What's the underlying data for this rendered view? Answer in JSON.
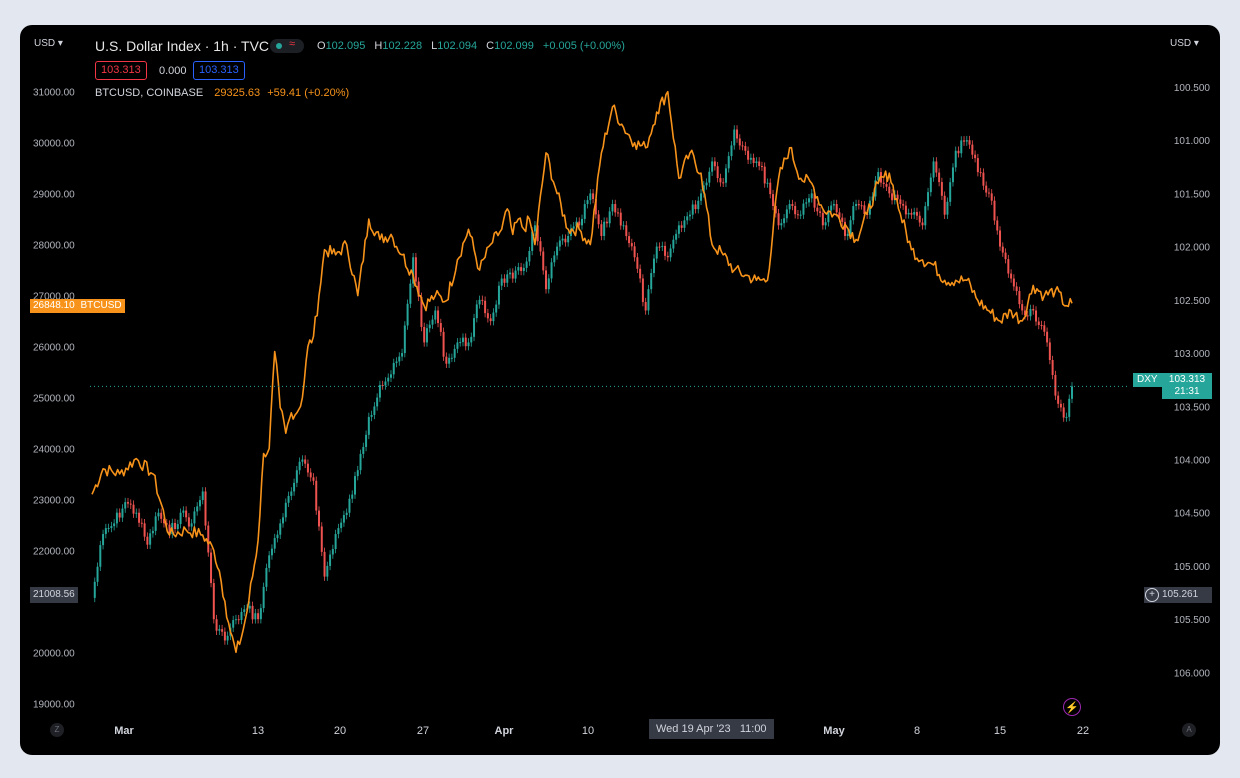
{
  "header": {
    "currency_left": "USD",
    "currency_right": "USD",
    "title": "U.S. Dollar Index · 1h · TVC",
    "wave_icon": "≈",
    "ohlc": [
      {
        "k": "O",
        "v": "102.095"
      },
      {
        "k": "H",
        "v": "102.228"
      },
      {
        "k": "L",
        "v": "102.094"
      },
      {
        "k": "C",
        "v": "102.099"
      }
    ],
    "change": "+0.005 (+0.00%)",
    "bid": "103.313",
    "spread": "0.000",
    "ask": "103.313",
    "btc_symbol": "BTCUSD, COINBASE",
    "btc_price": "29325.63",
    "btc_change": "+59.41 (+0.20%)"
  },
  "badges": {
    "btc_price": "26848.10",
    "btc_label": "BTCUSD",
    "dxy_label": "DXY",
    "dxy_price": "103.313",
    "dxy_countdown": "21:31",
    "left_crosshair": "21008.56",
    "right_crosshair": "105.261",
    "time_label": "Wed 19 Apr '23   11:00"
  },
  "footer": {
    "left_btn": "Z",
    "right_btn": "A"
  },
  "colors": {
    "btc": "#f7931a",
    "dxy_up": "#26a69a",
    "dxy_down": "#ef5350",
    "bg": "#000000"
  },
  "chart_data": {
    "type": "line",
    "x_ticks": [
      "Mar",
      "13",
      "20",
      "27",
      "Apr",
      "10",
      "Wed 19 Apr '23   11:00",
      "May",
      "8",
      "15",
      "22"
    ],
    "left_axis": {
      "ticks": [
        "31000.00",
        "30000.00",
        "29000.00",
        "28000.00",
        "27000.00",
        "26000.00",
        "25000.00",
        "24000.00",
        "23000.00",
        "22000.00",
        "20000.00",
        "19000.00"
      ],
      "range": [
        18770,
        31720
      ]
    },
    "right_axis": {
      "ticks": [
        "100.500",
        "101.000",
        "101.500",
        "102.000",
        "102.500",
        "103.000",
        "103.500",
        "104.000",
        "104.500",
        "105.000",
        "105.500",
        "106.000"
      ],
      "range": [
        100.2,
        106.4
      ],
      "inverted": true
    },
    "series": [
      {
        "name": "BTCUSD, COINBASE",
        "axis": "left",
        "x": [
          0,
          1,
          2.5,
          4,
          5.5,
          7,
          8.5,
          10,
          11,
          11.5,
          12,
          12.5,
          13,
          13.5,
          14,
          15,
          15.5,
          16,
          16.5,
          17,
          17.5,
          18,
          18.5,
          19,
          19.5,
          20,
          20.5,
          21,
          22,
          23,
          24,
          25,
          26,
          27,
          28,
          29,
          30,
          31,
          32,
          33,
          34,
          35,
          36,
          37,
          37.5,
          38,
          38.5,
          39,
          39.5,
          40,
          41,
          42,
          43,
          44,
          45,
          46,
          47,
          48,
          49,
          50,
          51,
          52,
          53,
          54,
          55,
          56,
          57,
          58,
          59,
          60,
          61,
          62,
          63,
          64,
          65,
          66,
          67,
          68,
          69,
          70,
          71,
          72,
          73,
          74,
          75,
          76,
          77,
          78,
          79,
          80,
          81,
          82,
          83,
          84,
          85,
          86,
          87,
          88,
          88.5
        ],
        "values": [
          23100,
          23600,
          23500,
          23800,
          23500,
          22300,
          22400,
          22300,
          22000,
          21600,
          21000,
          20400,
          20000,
          20300,
          20800,
          22200,
          23900,
          24000,
          25900,
          24800,
          24300,
          24700,
          24700,
          25000,
          26000,
          26200,
          27000,
          27900,
          27800,
          28000,
          27000,
          28500,
          28100,
          28200,
          27800,
          27400,
          26800,
          27000,
          26900,
          27700,
          28300,
          27500,
          28000,
          28300,
          28700,
          28200,
          28500,
          28300,
          28500,
          28000,
          29800,
          29000,
          28300,
          28300,
          28000,
          29800,
          30700,
          30300,
          30000,
          29900,
          30600,
          31000,
          29300,
          29800,
          29400,
          28000,
          27800,
          27500,
          27400,
          27300,
          27300,
          29300,
          29900,
          29300,
          29200,
          28700,
          28600,
          28400,
          28100,
          28600,
          29200,
          29400,
          28600,
          27900,
          27700,
          27600,
          27300,
          27300,
          27300,
          26900,
          26700,
          26500,
          26700,
          26500,
          27200,
          27000,
          27100,
          26800,
          26848
        ]
      },
      {
        "name": "U.S. Dollar Index · 1h · TVC",
        "axis": "right",
        "x": [
          0,
          1,
          2,
          3,
          4,
          5,
          6,
          7,
          8,
          9,
          10,
          11,
          12,
          13,
          14,
          15,
          16,
          17,
          18,
          19,
          20,
          21,
          22,
          23,
          24,
          25,
          26,
          27,
          28,
          29,
          30,
          31,
          32,
          33,
          34,
          35,
          36,
          37,
          38,
          39,
          40,
          41,
          42,
          43,
          44,
          45,
          46,
          47,
          48,
          49,
          50,
          51,
          52,
          53,
          54,
          55,
          56,
          57,
          58,
          59,
          60,
          61,
          62,
          63,
          64,
          65,
          66,
          67,
          68,
          69,
          70,
          71,
          72,
          73,
          74,
          75,
          76,
          77,
          78,
          79,
          80,
          81,
          82,
          83,
          84,
          85,
          86,
          87,
          88,
          88.5
        ],
        "values": [
          105.3,
          104.7,
          104.6,
          104.4,
          104.5,
          104.8,
          104.5,
          104.7,
          104.5,
          104.6,
          104.3,
          105.5,
          105.7,
          105.5,
          105.4,
          105.5,
          104.9,
          104.6,
          104.3,
          104.0,
          104.2,
          105.1,
          104.7,
          104.5,
          104.1,
          103.6,
          103.3,
          103.2,
          103.0,
          102.1,
          102.9,
          102.6,
          103.1,
          102.9,
          102.9,
          102.5,
          102.7,
          102.3,
          102.3,
          102.2,
          101.8,
          102.4,
          102.0,
          101.9,
          101.8,
          101.5,
          101.9,
          101.6,
          101.8,
          102.1,
          102.6,
          102.0,
          102.1,
          101.8,
          101.7,
          101.5,
          101.2,
          101.4,
          100.9,
          101.1,
          101.2,
          101.4,
          101.8,
          101.6,
          101.7,
          101.5,
          101.8,
          101.6,
          101.9,
          101.6,
          101.7,
          101.3,
          101.5,
          101.6,
          101.7,
          101.8,
          101.2,
          101.7,
          101.1,
          101.0,
          101.3,
          101.5,
          102.0,
          102.3,
          102.6,
          102.6,
          102.8,
          103.4,
          103.6,
          103.313
        ]
      }
    ],
    "price_lines": [
      {
        "axis": "right",
        "value": 103.313
      }
    ]
  }
}
